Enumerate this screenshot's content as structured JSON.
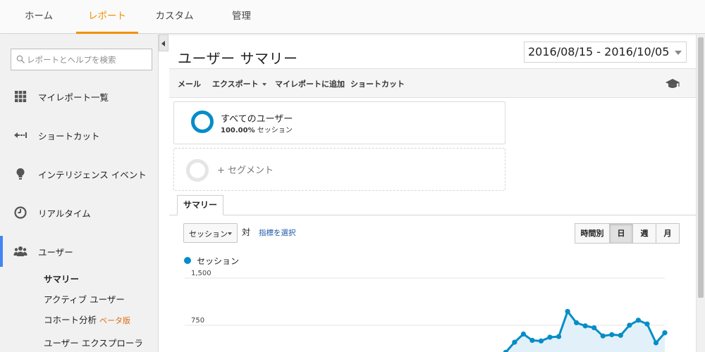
{
  "topnav": {
    "tabs": [
      "ホーム",
      "レポート",
      "カスタム",
      "管理"
    ],
    "active": 1
  },
  "search": {
    "placeholder": "レポートとヘルプを検索"
  },
  "sidebar": {
    "items": [
      {
        "label": "マイレポート一覧",
        "icon": "grid-icon"
      },
      {
        "label": "ショートカット",
        "icon": "shortcut-arrow-icon"
      },
      {
        "label": "インテリジェンス イベント",
        "icon": "lightbulb-icon"
      },
      {
        "label": "リアルタイム",
        "icon": "clock-icon"
      },
      {
        "label": "ユーザー",
        "icon": "users-icon"
      }
    ],
    "subitems": [
      "サマリー",
      "アクティブ ユーザー",
      "コホート分析",
      "ユーザー エクスプローラ"
    ],
    "beta": "ベータ版"
  },
  "main": {
    "title": "ユーザー サマリー",
    "date_range": "2016/08/15 - 2016/10/05"
  },
  "toolbar": {
    "mail": "メール",
    "export": "エクスポート",
    "add_to_dashboard": "マイレポートに追加",
    "shortcut": "ショートカット"
  },
  "segments": {
    "all_users": "すべてのユーザー",
    "pct": "100.00%",
    "pct_label": "セッション",
    "add": "+ セグメント"
  },
  "tabs": {
    "summary": "サマリー"
  },
  "controls": {
    "metric": "セッション",
    "vs": "対",
    "pick_metric": "指標を選択",
    "periods": [
      "時間別",
      "日",
      "週",
      "月"
    ],
    "active_period": 1
  },
  "colors": {
    "accent": "#f29100",
    "series": "#058dc7",
    "sidebar_active": "#4285f4"
  },
  "chart_data": {
    "type": "area",
    "series": [
      {
        "name": "セッション",
        "values": [
          null,
          null,
          null,
          null,
          null,
          null,
          null,
          null,
          null,
          null,
          null,
          null,
          null,
          null,
          null,
          null,
          null,
          null,
          null,
          null,
          null,
          null,
          null,
          150,
          150,
          170,
          180,
          190,
          210,
          210,
          270,
          260,
          210,
          200,
          200,
          160,
          320,
          480,
          610,
          510,
          500,
          560,
          570,
          970,
          790,
          740,
          710,
          580,
          600,
          590,
          750,
          830,
          770,
          470,
          630
        ]
      }
    ],
    "ytick_labels": [
      "1,500",
      "750"
    ],
    "ylim": [
      0,
      1500
    ],
    "grid": true
  }
}
